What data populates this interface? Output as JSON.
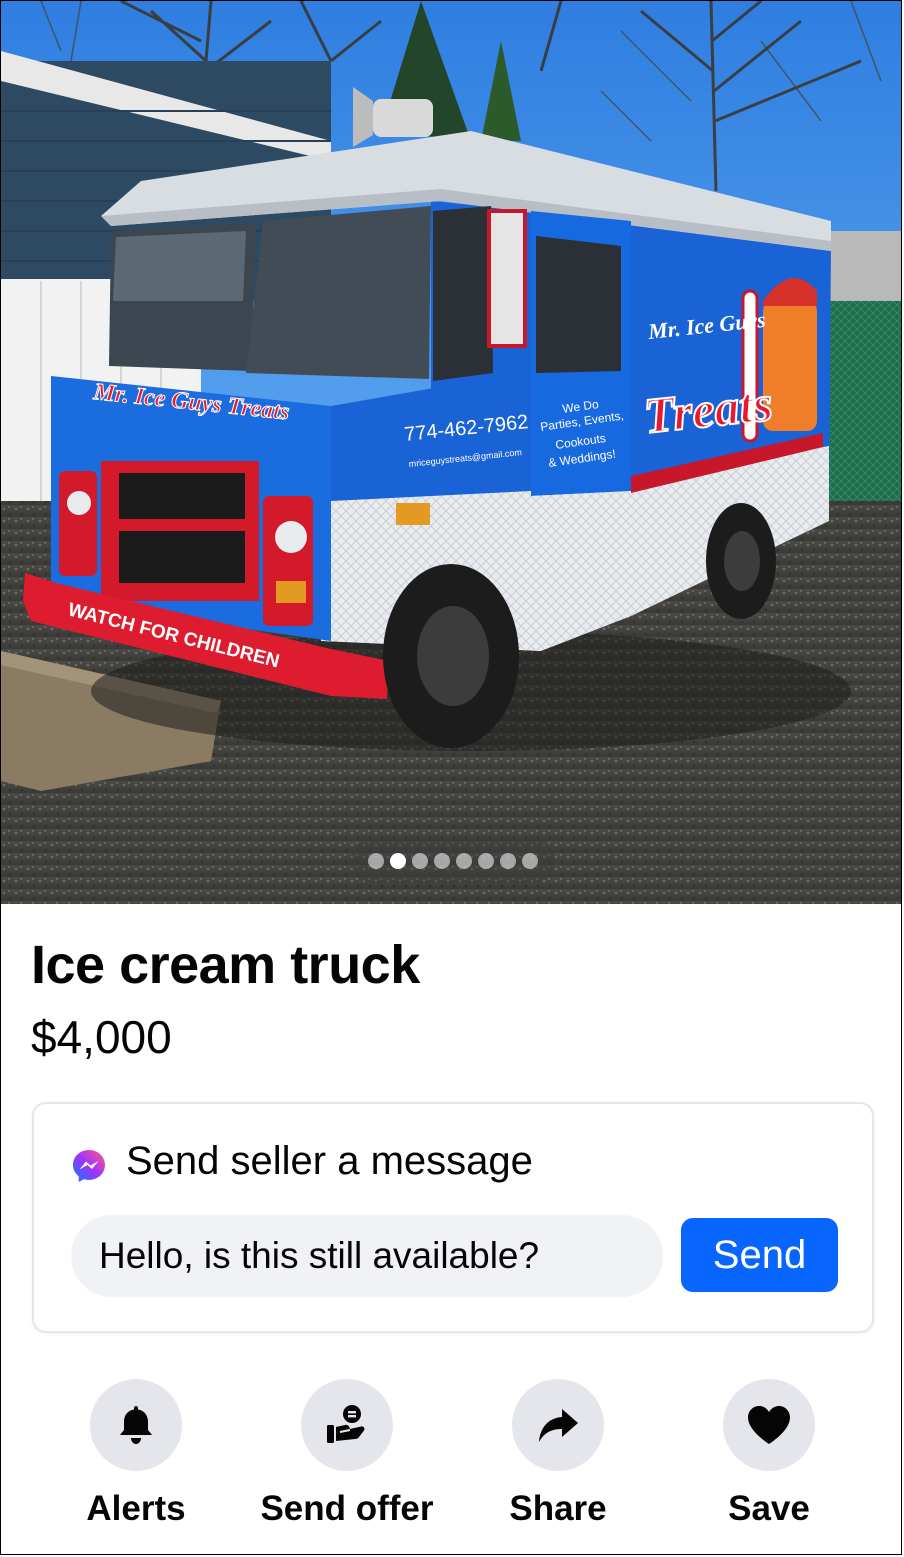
{
  "listing": {
    "title": "Ice cream truck",
    "price": "$4,000",
    "photo": {
      "total_images": 8,
      "active_index": 1,
      "truck_text": {
        "brand_side": "Mr. Ice Guys",
        "brand_hood": "Mr. Ice Guys Treats",
        "treats": "Treats",
        "phone": "774-462-7962",
        "email": "mriceguystreats@gmail.com",
        "services": [
          "We Do",
          "Parties, Events,",
          "Cookouts",
          "& Weddings!"
        ],
        "bumper": "WATCH FOR CHILDREN"
      }
    }
  },
  "message_card": {
    "heading": "Send seller a message",
    "icon": "messenger-icon",
    "input_value": "Hello, is this still available?",
    "send_label": "Send",
    "accent": "#0866ff"
  },
  "actions": [
    {
      "label": "Alerts",
      "icon": "bell-icon"
    },
    {
      "label": "Send offer",
      "icon": "offer-icon"
    },
    {
      "label": "Share",
      "icon": "share-icon"
    },
    {
      "label": "Save",
      "icon": "heart-icon"
    }
  ]
}
